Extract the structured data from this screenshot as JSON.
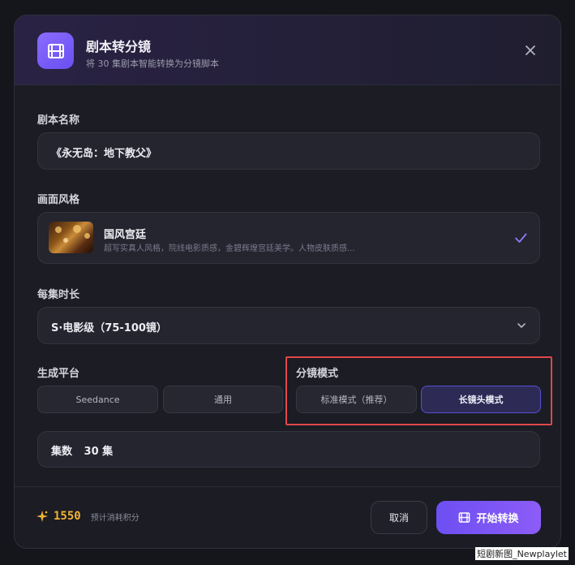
{
  "header": {
    "title": "剧本转分镜",
    "subtitle": "将 30 集剧本智能转换为分镜脚本"
  },
  "script_name": {
    "label": "剧本名称",
    "value": "《永无岛：地下教父》"
  },
  "visual_style": {
    "label": "画面风格",
    "name": "国风宫廷",
    "description": "超写实真人风格，院线电影质感，金碧辉煌宫廷美学。人物皮肤质感..."
  },
  "episode_duration": {
    "label": "每集时长",
    "value": "S·电影级（75-100镜）"
  },
  "platform": {
    "label": "生成平台",
    "options": [
      "Seedance",
      "通用"
    ]
  },
  "storyboard_mode": {
    "label": "分镜模式",
    "options": [
      "标准模式（推荐）",
      "长镜头模式"
    ],
    "selected": "长镜头模式"
  },
  "episode_count": {
    "label": "集数",
    "value": "30 集"
  },
  "footer": {
    "credits": "1550",
    "credits_label": "预计消耗积分",
    "cancel_label": "取消",
    "start_label": "开始转换"
  },
  "watermark": "短剧新图_Newplaylet",
  "colors": {
    "accent": "#6d4ff2",
    "credit": "#f2b233",
    "highlight": "#e0484a"
  }
}
